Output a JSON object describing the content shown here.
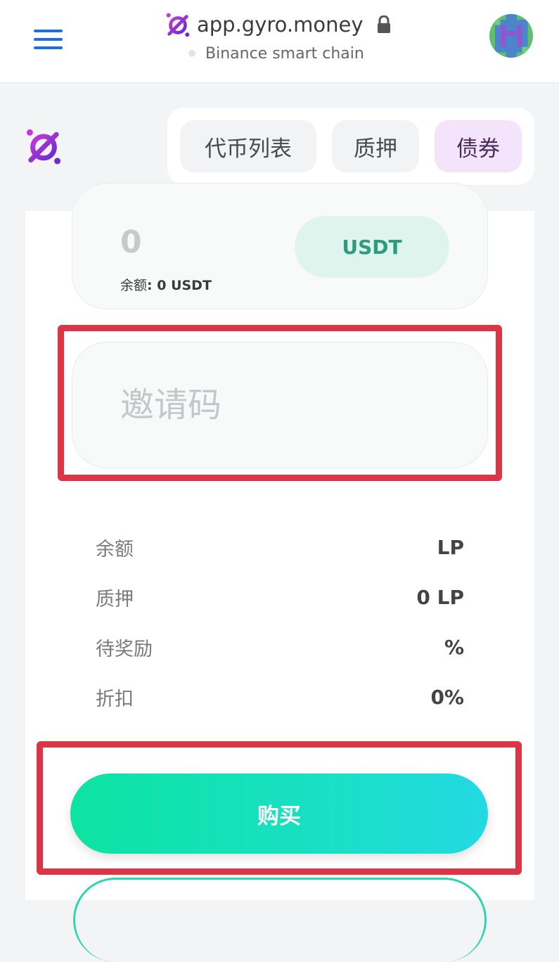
{
  "browser": {
    "menu_icon": "hamburger-menu-icon",
    "url": "app.gyro.money",
    "lock_icon": "lock-icon",
    "network": "Binance smart chain",
    "avatar_icon": "pixel-avatar"
  },
  "nav": {
    "logo_icon": "gyro-logo-icon",
    "tabs": [
      {
        "label": "代币列表",
        "active": false
      },
      {
        "label": "质押",
        "active": false
      },
      {
        "label": "债券",
        "active": true
      }
    ]
  },
  "bond": {
    "amount_value": "0",
    "balance_label": "余额",
    "balance_value": ": 0 USDT",
    "token_button": "USDT",
    "invite_placeholder": "邀请码",
    "info": [
      {
        "label": "余额",
        "value": "LP"
      },
      {
        "label": "质押",
        "value": "0 LP"
      },
      {
        "label": "待奖励",
        "value": "%"
      },
      {
        "label": "折扣",
        "value": "0%"
      }
    ],
    "buy_button": "购买"
  },
  "colors": {
    "accent_purple": "#8e2ad6",
    "highlight_red": "#dc3545",
    "buy_gradient_start": "#0de3a2",
    "buy_gradient_end": "#23d9e2",
    "token_green": "#2c9d7a"
  }
}
